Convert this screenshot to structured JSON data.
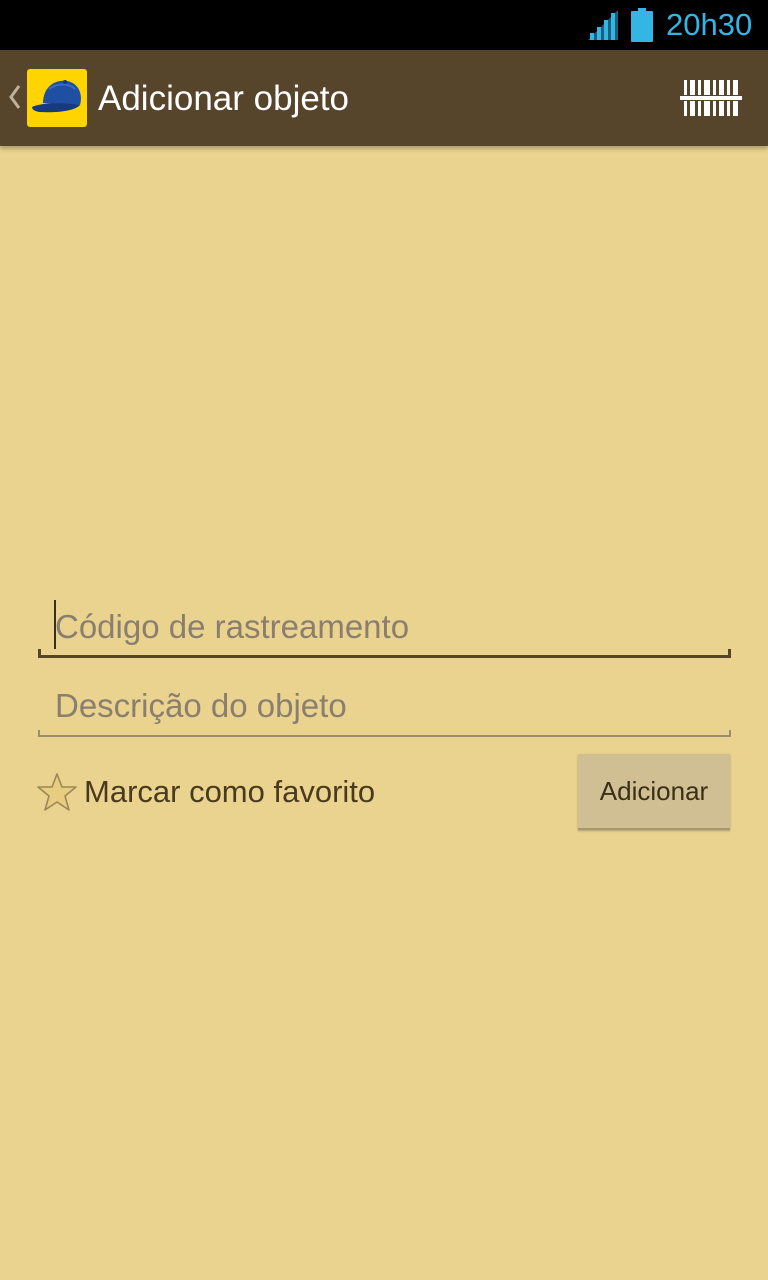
{
  "status_bar": {
    "time": "20h30",
    "icons": [
      "signal-icon",
      "battery-icon"
    ],
    "accent_color": "#33b5e5"
  },
  "action_bar": {
    "title": "Adicionar objeto",
    "background_color": "#56452a",
    "icons": [
      "up-caret-icon",
      "app-cap-icon",
      "barcode-scan-icon"
    ]
  },
  "form": {
    "tracking_field": {
      "placeholder": "Código de rastreamento",
      "value": ""
    },
    "description_field": {
      "placeholder": "Descrição do objeto",
      "value": ""
    },
    "favorite": {
      "label": "Marcar como favorito",
      "checked": false,
      "icon": "star-icon"
    },
    "add_button_label": "Adicionar"
  },
  "colors": {
    "background": "#ead38f",
    "button": "#cfbf92"
  }
}
